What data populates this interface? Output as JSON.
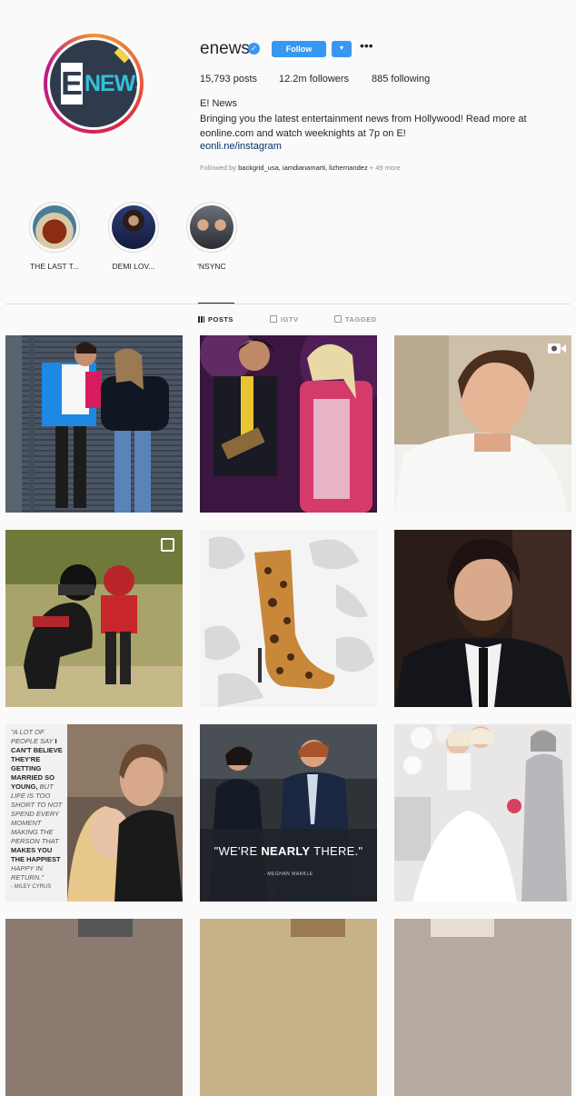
{
  "profile": {
    "username": "enews",
    "follow_label": "Follow",
    "posts_count": "15,793",
    "posts_label": "posts",
    "followers_count": "12.2m",
    "followers_label": "followers",
    "following_count": "885",
    "following_label": "following",
    "full_name": "E! News",
    "bio_line1": "Bringing you the latest entertainment news from Hollywood! Read more at",
    "bio_line2": "eonline.com and watch weeknights at 7p on E!",
    "link": "eonli.ne/instagram",
    "followed_by_prefix": "Followed by",
    "followed_by_names": "backgrid_usa, iamdianamarti, lizhernandez",
    "followed_by_more": "+ 49 more",
    "logo_letter": "E",
    "logo_word": "NEWS"
  },
  "highlights": [
    {
      "label": "THE LAST T...",
      "icon": "food-thumbnail"
    },
    {
      "label": "DEMI LOV...",
      "icon": "person-thumbnail"
    },
    {
      "label": "'NSYNC",
      "icon": "group-thumbnail"
    }
  ],
  "tabs": [
    {
      "label": "POSTS",
      "active": true,
      "icon": "grid-icon"
    },
    {
      "label": "IGTV",
      "active": false,
      "icon": "tv-icon"
    },
    {
      "label": "TAGGED",
      "active": false,
      "icon": "tag-icon"
    }
  ],
  "posts": {
    "quote_lines": {
      "p1": "\"A lot of people say ",
      "p2": "I can't believe they're getting married so young,",
      "p3": " but life is too short to not spend every moment making the person that ",
      "p4": "makes you the happiest",
      "p5": " happy in return.\"",
      "credit": "- MILEY CYRUS"
    },
    "nearly_prefix": "\"WE'RE ",
    "nearly_bold": "NEARLY",
    "nearly_suffix": " THERE.\"",
    "nearly_credit": "- MEGHAN MARKLE"
  },
  "colors": {
    "accent": "#3897f0",
    "text": "#262626",
    "muted": "#8e8e8e",
    "border": "#dbdbdb",
    "background": "#fafafa"
  }
}
